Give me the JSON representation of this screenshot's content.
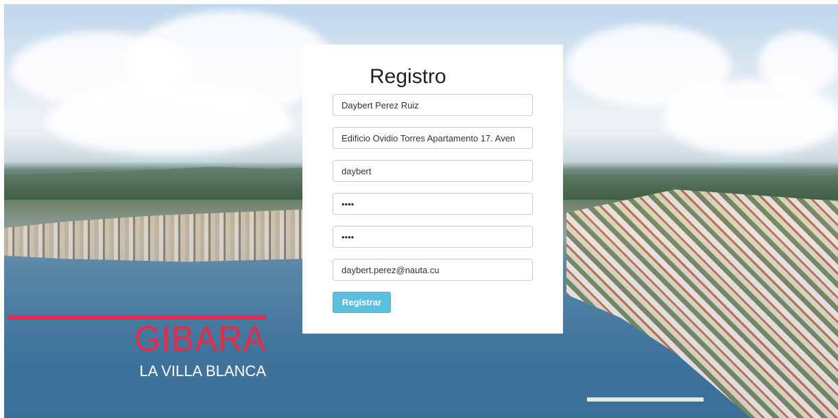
{
  "background": {
    "logo_title": "GIBARA",
    "logo_subtitle": "LA VILLA BLANCA",
    "accent_color": "#e22c4c"
  },
  "form": {
    "title": "Registro",
    "fields": {
      "full_name": "Daybert Perez Ruiz",
      "address": "Edificio Ovidio Torres Apartamento 17. Aven",
      "username": "daybert",
      "password": "••••",
      "password_confirm": "••••",
      "email": "daybert.perez@nauta.cu"
    },
    "submit_label": "Registrar",
    "submit_color": "#5bc0de"
  }
}
